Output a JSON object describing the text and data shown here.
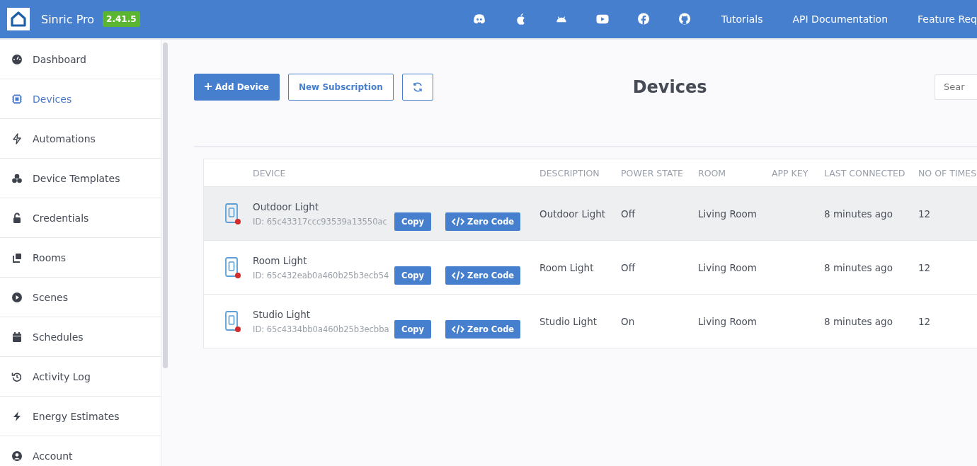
{
  "header": {
    "brand": "Sinric Pro",
    "version": "2.41.5",
    "links": [
      "Tutorials",
      "API Documentation",
      "Feature Req"
    ]
  },
  "sidebar": {
    "items": [
      {
        "label": "Dashboard",
        "selected": false
      },
      {
        "label": "Devices",
        "selected": true
      },
      {
        "label": "Automations",
        "selected": false
      },
      {
        "label": "Device Templates",
        "selected": false
      },
      {
        "label": "Credentials",
        "selected": false
      },
      {
        "label": "Rooms",
        "selected": false
      },
      {
        "label": "Scenes",
        "selected": false
      },
      {
        "label": "Schedules",
        "selected": false
      },
      {
        "label": "Activity Log",
        "selected": false
      },
      {
        "label": "Energy Estimates",
        "selected": false
      },
      {
        "label": "Account",
        "selected": false
      }
    ]
  },
  "toolbar": {
    "add_button": "Add Device",
    "subscription_button": "New Subscription",
    "search": {
      "placeholder": "Sear"
    }
  },
  "page_title": "Devices",
  "table": {
    "columns": [
      "DEVICE",
      "DESCRIPTION",
      "POWER STATE",
      "ROOM",
      "APP KEY",
      "LAST CONNECTED",
      "NO OF TIMES"
    ],
    "rows": [
      {
        "name": "Outdoor Light",
        "id": "ID: 65c43317ccc93539a13550ac",
        "copy": "Copy",
        "zero_code": "Zero Code",
        "description": "Outdoor Light",
        "power_state": "Off",
        "room": "Living Room",
        "last_connected": "8 minutes ago",
        "times": "12",
        "online": false,
        "highlighted": true
      },
      {
        "name": "Room Light",
        "id": "ID: 65c432eab0a460b25b3ecb54",
        "copy": "Copy",
        "zero_code": "Zero Code",
        "description": "Room Light",
        "power_state": "Off",
        "room": "Living Room",
        "last_connected": "8 minutes ago",
        "times": "12",
        "online": false,
        "highlighted": false
      },
      {
        "name": "Studio Light",
        "id": "ID: 65c4334bb0a460b25b3ecbba",
        "copy": "Copy",
        "zero_code": "Zero Code",
        "description": "Studio Light",
        "power_state": "On",
        "room": "Living Room",
        "last_connected": "8 minutes ago",
        "times": "12",
        "online": false,
        "highlighted": false
      }
    ]
  }
}
